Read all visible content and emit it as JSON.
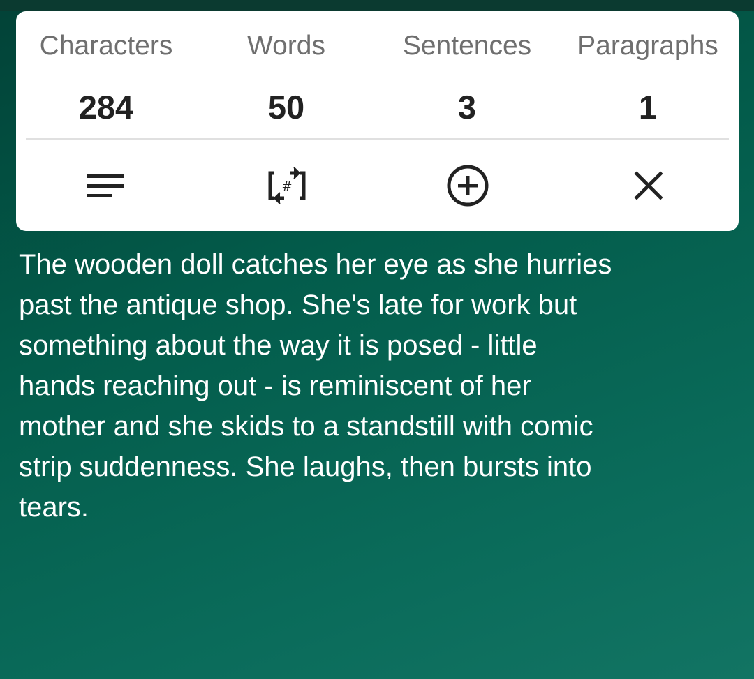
{
  "stats": [
    {
      "label": "Characters",
      "value": "284"
    },
    {
      "label": "Words",
      "value": "50"
    },
    {
      "label": "Sentences",
      "value": "3"
    },
    {
      "label": "Paragraphs",
      "value": "1"
    }
  ],
  "actions": [
    {
      "icon": "lines-icon"
    },
    {
      "icon": "count-toggle-icon",
      "glyph": "#"
    },
    {
      "icon": "add-circle-icon"
    },
    {
      "icon": "close-icon"
    }
  ],
  "text": {
    "line1": "The wooden doll catches her eye as she hurries",
    "line2": "past the antique shop. She's late for work but",
    "line3": "something about the way it is posed - little",
    "line4": "hands reaching out - is reminiscent of her",
    "line5": "mother and she skids to a standstill with comic",
    "line6": "strip suddenness. She laughs, then bursts into",
    "line7": "tears."
  },
  "colors": {
    "background": "#035c4b",
    "panel": "#ffffff",
    "label": "#6f6f6f",
    "value": "#222222"
  }
}
